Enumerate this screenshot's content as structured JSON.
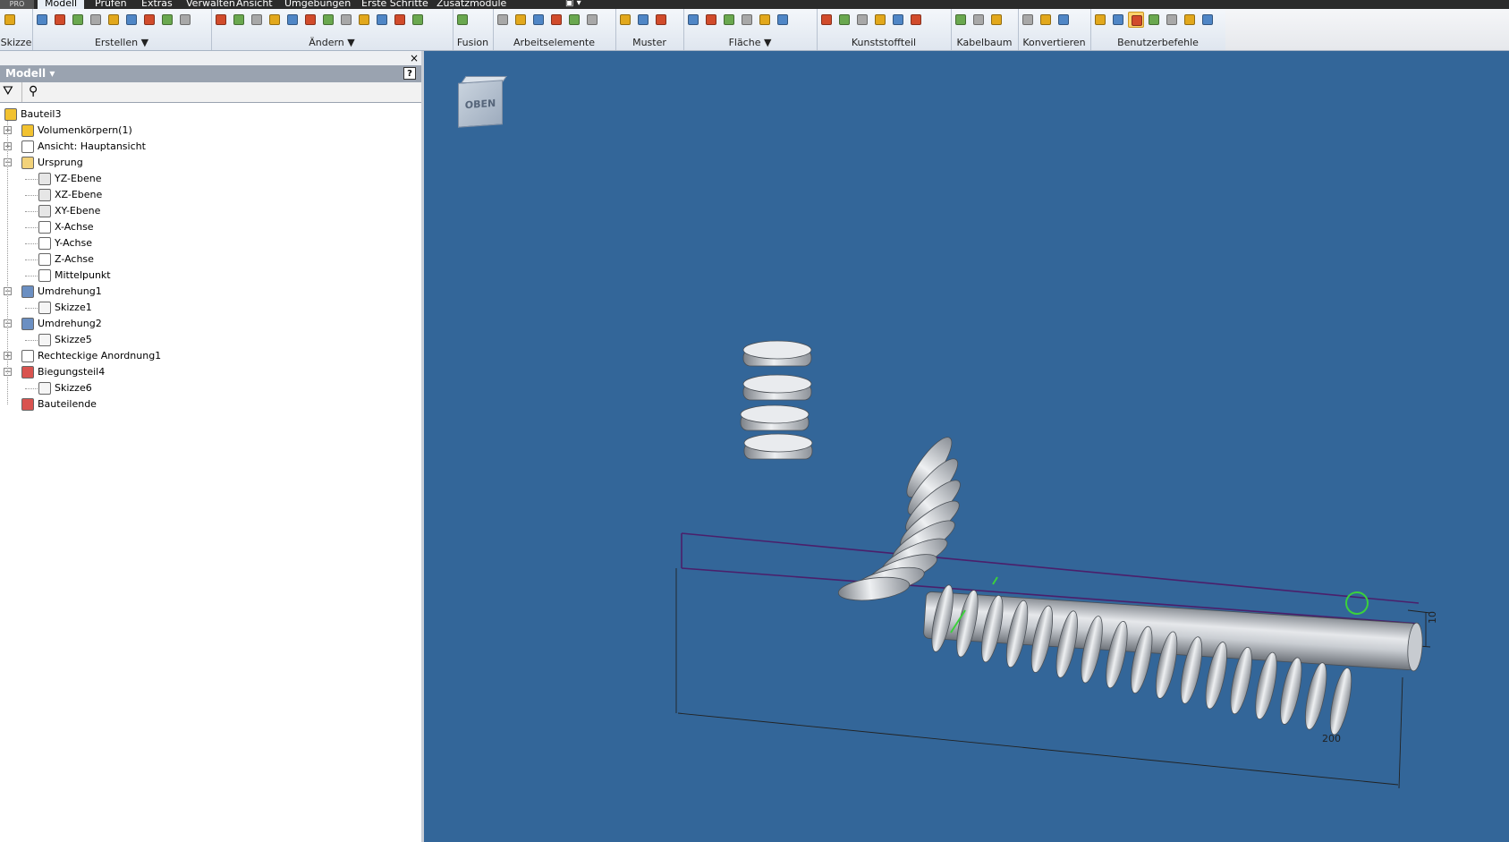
{
  "menu": {
    "badge": "PRO",
    "items": [
      {
        "label": "Modell",
        "active": true
      },
      {
        "label": "Prüfen"
      },
      {
        "label": "Extras"
      },
      {
        "label": "Verwalten"
      },
      {
        "label": "Ansicht"
      },
      {
        "label": "Umgebungen"
      },
      {
        "label": "Erste Schritte"
      },
      {
        "label": "Zusatzmodule"
      }
    ]
  },
  "ribbon": {
    "groups": [
      {
        "label": "Skizze",
        "icons": 2
      },
      {
        "label": "Erstellen ▼",
        "icons": 9
      },
      {
        "label": "Ändern ▼",
        "icons": 11
      },
      {
        "label": "Fusion",
        "icons": 1
      },
      {
        "label": "Arbeitselemente",
        "icons": 4
      },
      {
        "label": "Muster",
        "icons": 3
      },
      {
        "label": "Fläche ▼",
        "icons": 6
      },
      {
        "label": "Kunststoffteil",
        "icons": 6
      },
      {
        "label": "Kabelbaum",
        "icons": 3
      },
      {
        "label": "Konvertieren",
        "icons": 1
      },
      {
        "label": "Benutzerbefehle",
        "icons": 6
      }
    ],
    "icon_colors": [
      "#e2a81c",
      "#4f86c6",
      "#d14b2b",
      "#6aa84f",
      "#a8a8a8"
    ]
  },
  "browser": {
    "title": "Modell ▾",
    "close": "×",
    "help": "?",
    "filter_icon": "filter-icon",
    "find_icon": "binoculars-icon",
    "tree": [
      {
        "label": "Bauteil3",
        "level": 0,
        "icon": "part-icon",
        "color": "#f2c230"
      },
      {
        "label": "Volumenkörpern(1)",
        "level": 1,
        "expander": "+",
        "icon": "solid-bodies-icon",
        "color": "#f2c230"
      },
      {
        "label": "Ansicht: Hauptansicht",
        "level": 1,
        "expander": "+",
        "icon": "view-icon",
        "color": "#ffffff"
      },
      {
        "label": "Ursprung",
        "level": 1,
        "expander": "−",
        "icon": "folder-icon",
        "color": "#f2d27a"
      },
      {
        "label": "YZ-Ebene",
        "level": 2,
        "icon": "plane-icon",
        "color": "#e6e6e6"
      },
      {
        "label": "XZ-Ebene",
        "level": 2,
        "icon": "plane-icon",
        "color": "#e6e6e6"
      },
      {
        "label": "XY-Ebene",
        "level": 2,
        "icon": "plane-icon",
        "color": "#e6e6e6"
      },
      {
        "label": "X-Achse",
        "level": 2,
        "icon": "axis-icon",
        "color": "#ffffff"
      },
      {
        "label": "Y-Achse",
        "level": 2,
        "icon": "axis-icon",
        "color": "#ffffff"
      },
      {
        "label": "Z-Achse",
        "level": 2,
        "icon": "axis-icon",
        "color": "#ffffff"
      },
      {
        "label": "Mittelpunkt",
        "level": 2,
        "icon": "point-icon",
        "color": "#ffffff"
      },
      {
        "label": "Umdrehung1",
        "level": 1,
        "expander": "−",
        "icon": "revolve-icon",
        "color": "#6b8fc2"
      },
      {
        "label": "Skizze1",
        "level": 2,
        "icon": "sketch-icon",
        "color": "#f5f5f5"
      },
      {
        "label": "Umdrehung2",
        "level": 1,
        "expander": "−",
        "icon": "revolve-icon",
        "color": "#6b8fc2"
      },
      {
        "label": "Skizze5",
        "level": 2,
        "icon": "sketch-icon",
        "color": "#f5f5f5"
      },
      {
        "label": "Rechteckige Anordnung1",
        "level": 1,
        "expander": "+",
        "icon": "pattern-icon",
        "color": "#ffffff"
      },
      {
        "label": "Biegungsteil4",
        "level": 1,
        "expander": "−",
        "icon": "bend-icon",
        "color": "#d9534f"
      },
      {
        "label": "Skizze6",
        "level": 2,
        "icon": "sketch-icon",
        "color": "#f5f5f5"
      },
      {
        "label": "Bauteilende",
        "level": 1,
        "icon": "end-of-part-icon",
        "color": "#d9534f"
      }
    ]
  },
  "viewport": {
    "background": "#336699",
    "viewcube_label": "OBEN",
    "dimension_length": "200",
    "dimension_diameter": "10"
  }
}
